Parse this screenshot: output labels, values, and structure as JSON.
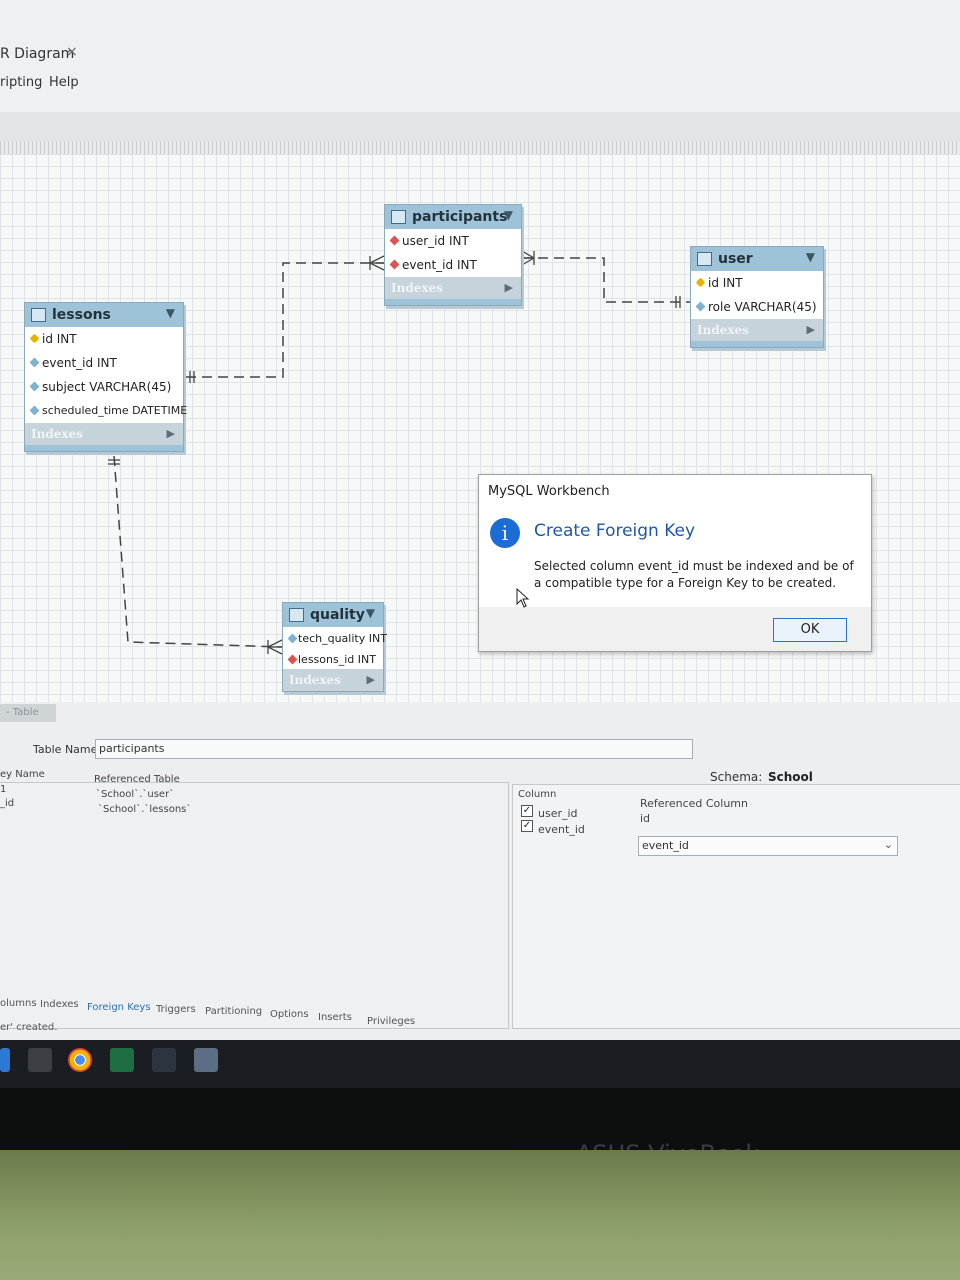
{
  "window": {
    "tab_title": "R Diagram",
    "tab_close": "×"
  },
  "menu": {
    "items": [
      "ripting",
      "Help"
    ]
  },
  "diagram": {
    "tables": [
      {
        "name": "participants",
        "columns": [
          {
            "label": "user_id INT",
            "kind": "fk"
          },
          {
            "label": "event_id INT",
            "kind": "fk"
          }
        ],
        "indexes_label": "Indexes"
      },
      {
        "name": "user",
        "columns": [
          {
            "label": "id INT",
            "kind": "key"
          },
          {
            "label": "role VARCHAR(45)",
            "kind": "plain"
          }
        ],
        "indexes_label": "Indexes"
      },
      {
        "name": "lessons",
        "columns": [
          {
            "label": "id INT",
            "kind": "key"
          },
          {
            "label": "event_id INT",
            "kind": "plain"
          },
          {
            "label": "subject VARCHAR(45)",
            "kind": "plain"
          },
          {
            "label": "scheduled_time DATETIME",
            "kind": "plain"
          }
        ],
        "indexes_label": "Indexes"
      },
      {
        "name": "quality",
        "columns": [
          {
            "label": "tech_quality INT",
            "kind": "plain"
          },
          {
            "label": "lessons_id INT",
            "kind": "fk"
          }
        ],
        "indexes_label": "Indexes"
      }
    ]
  },
  "dialog": {
    "window_title": "MySQL Workbench",
    "icon": "info-icon",
    "heading": "Create Foreign Key",
    "message": "Selected column event_id must be indexed and be of a compatible type for a Foreign Key to be created.",
    "ok_label": "OK",
    "accent_color": "#1c6cd3"
  },
  "editor": {
    "tab_label": "- Table",
    "table_name_label": "Table Name:",
    "table_name_value": "participants",
    "schema_label": "Schema:",
    "schema_value": "School",
    "fk_headers": {
      "key_name": "ey Name",
      "referenced_table": "Referenced Table"
    },
    "fk_rows": [
      {
        "key": "1",
        "table": "`School`.`user`"
      },
      {
        "key": "_id",
        "table": "`School`.`lessons`"
      }
    ],
    "col_headers": {
      "column": "Column",
      "referenced_column": "Referenced Column"
    },
    "col_rows": [
      {
        "checked": "✓",
        "column": "user_id",
        "ref": "id"
      },
      {
        "checked": "✓",
        "column": "event_id",
        "ref": "event_id"
      }
    ],
    "subtabs": [
      "olumns",
      "Indexes",
      "Foreign Keys",
      "Triggers",
      "Partitioning",
      "Options",
      "Inserts",
      "Privileges"
    ],
    "status": "er' created."
  },
  "taskbar": {
    "icons": [
      "start-icon",
      "store-icon",
      "chrome-icon",
      "excel-icon",
      "workbench-icon",
      "notes-icon"
    ]
  },
  "device": {
    "brand": "ASUS VivoBook"
  }
}
